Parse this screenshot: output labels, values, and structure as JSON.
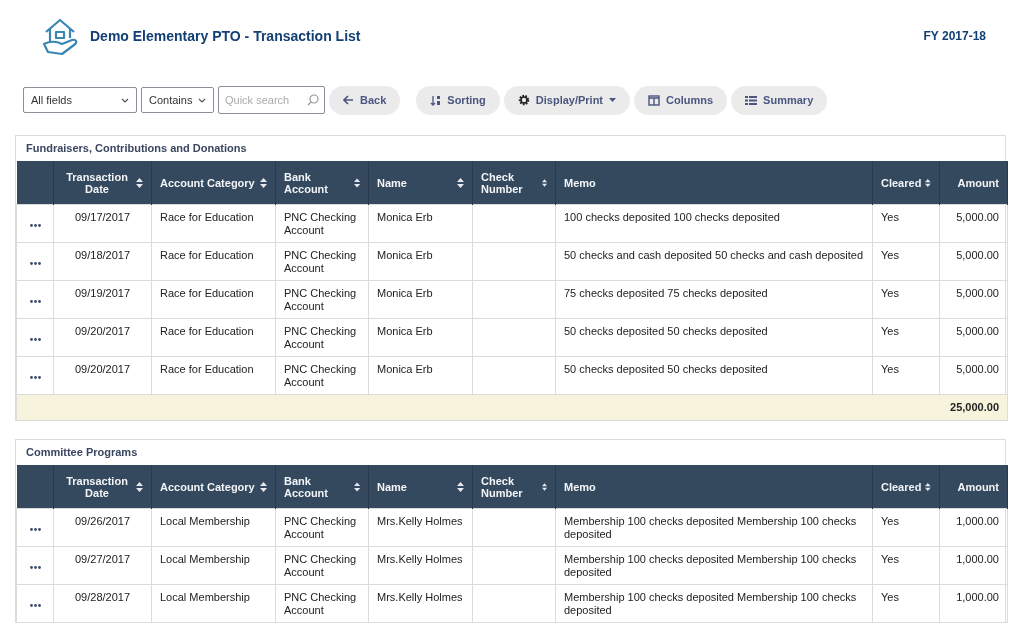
{
  "header": {
    "title": "Demo Elementary PTO - Transaction List",
    "fiscal_year": "FY 2017-18"
  },
  "toolbar": {
    "field_select": "All fields",
    "operator_select": "Contains",
    "search": {
      "placeholder": "Quick search"
    },
    "buttons": [
      {
        "label": "Back",
        "dropdown": false
      },
      {
        "label": "Sorting",
        "dropdown": false
      },
      {
        "label": "Display/Print",
        "dropdown": true
      },
      {
        "label": "Columns",
        "dropdown": false
      },
      {
        "label": "Summary",
        "dropdown": false
      }
    ]
  },
  "sections": [
    {
      "title": "Fundraisers, Contributions and Donations",
      "columns": [
        {
          "label": "Transaction Date",
          "sortable": true
        },
        {
          "label": "Account Category",
          "sortable": true
        },
        {
          "label": "Bank Account",
          "sortable": true
        },
        {
          "label": "Name",
          "sortable": true
        },
        {
          "label": "Check Number",
          "sortable": true
        },
        {
          "label": "Memo",
          "sortable": false
        },
        {
          "label": "Cleared",
          "sortable": true
        },
        {
          "label": "Amount",
          "sortable": false
        }
      ],
      "total": "25,000.00",
      "rows": [
        {
          "date": "09/17/2017",
          "category": "Race for Education",
          "bank": "PNC Checking Account",
          "name": "Monica Erb",
          "memo": "100 checks deposited 100 checks deposited",
          "cleared": "Yes",
          "amount": "5,000.00"
        },
        {
          "date": "09/18/2017",
          "category": "Race for Education",
          "bank": "PNC Checking Account",
          "name": "Monica Erb",
          "memo": "50 checks and cash deposited 50 checks and cash deposited",
          "cleared": "Yes",
          "amount": "5,000.00"
        },
        {
          "date": "09/19/2017",
          "category": "Race for Education",
          "bank": "PNC Checking Account",
          "name": "Monica Erb",
          "memo": "75 checks deposited 75 checks deposited",
          "cleared": "Yes",
          "amount": "5,000.00"
        },
        {
          "date": "09/20/2017",
          "category": "Race for Education",
          "bank": "PNC Checking Account",
          "name": "Monica Erb",
          "memo": "50 checks deposited 50 checks deposited",
          "cleared": "Yes",
          "amount": "5,000.00"
        },
        {
          "date": "09/20/2017",
          "category": "Race for Education",
          "bank": "PNC Checking Account",
          "name": "Monica Erb",
          "memo": "50 checks deposited 50 checks deposited",
          "cleared": "Yes",
          "amount": "5,000.00"
        }
      ]
    },
    {
      "title": "Committee Programs",
      "columns": [
        {
          "label": "Transaction Date",
          "sortable": true
        },
        {
          "label": "Account Category",
          "sortable": true
        },
        {
          "label": "Bank Account",
          "sortable": true
        },
        {
          "label": "Name",
          "sortable": true
        },
        {
          "label": "Check Number",
          "sortable": true
        },
        {
          "label": "Memo",
          "sortable": false
        },
        {
          "label": "Cleared",
          "sortable": true
        },
        {
          "label": "Amount",
          "sortable": false
        }
      ],
      "rows": [
        {
          "date": "09/26/2017",
          "category": "Local Membership",
          "bank": "PNC Checking Account",
          "name": "Mrs.Kelly Holmes",
          "memo": "Membership 100 checks deposited Membership 100 checks deposited",
          "cleared": "Yes",
          "amount": "1,000.00"
        },
        {
          "date": "09/27/2017",
          "category": "Local Membership",
          "bank": "PNC Checking Account",
          "name": "Mrs.Kelly Holmes",
          "memo": "Membership 100 checks deposited Membership 100 checks deposited",
          "cleared": "Yes",
          "amount": "1,000.00"
        },
        {
          "date": "09/28/2017",
          "category": "Local Membership",
          "bank": "PNC Checking Account",
          "name": "Mrs.Kelly Holmes",
          "memo": "Membership 100 checks deposited Membership 100 checks deposited",
          "cleared": "Yes",
          "amount": "1,000.00"
        }
      ]
    }
  ]
}
